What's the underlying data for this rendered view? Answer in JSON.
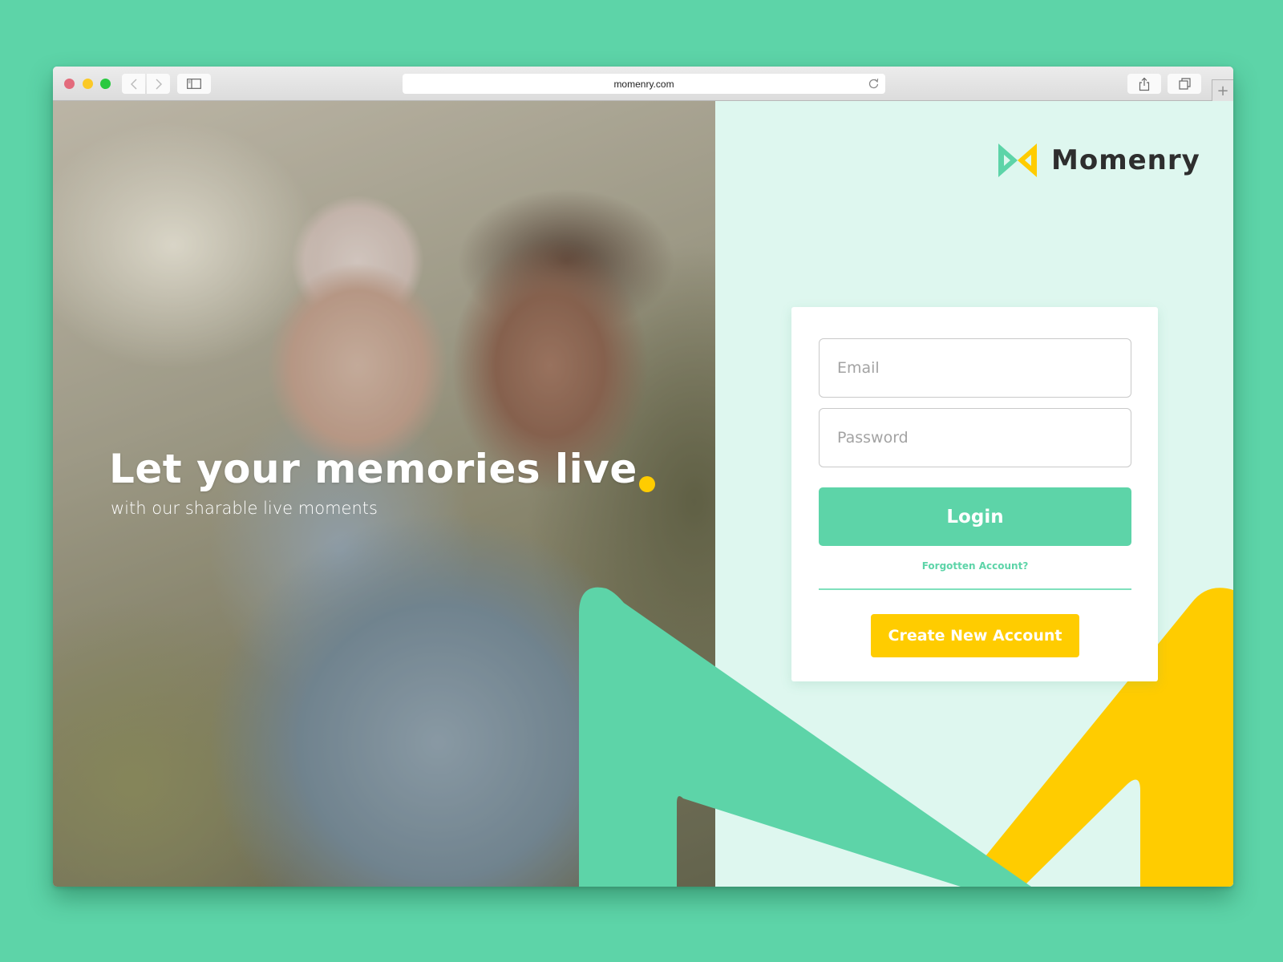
{
  "browser": {
    "url": "momenry.com",
    "buttons": {
      "back": "back-icon",
      "forward": "forward-icon",
      "sidebar": "sidebar-icon",
      "reload": "reload-icon",
      "share": "share-icon",
      "tabs": "tabs-icon",
      "new_tab": "+"
    }
  },
  "hero": {
    "title": "Let your memories live",
    "subtitle": "with our sharable live moments"
  },
  "brand": {
    "name": "Momenry",
    "colors": {
      "primary": "#5dd4a8",
      "accent": "#ffcc00",
      "panel_bg": "#def7ef",
      "text_dark": "#2e2e2e"
    }
  },
  "login_form": {
    "email_placeholder": "Email",
    "password_placeholder": "Password",
    "login_label": "Login",
    "forgot_label": "Forgotten Account?",
    "create_label": "Create New Account"
  }
}
